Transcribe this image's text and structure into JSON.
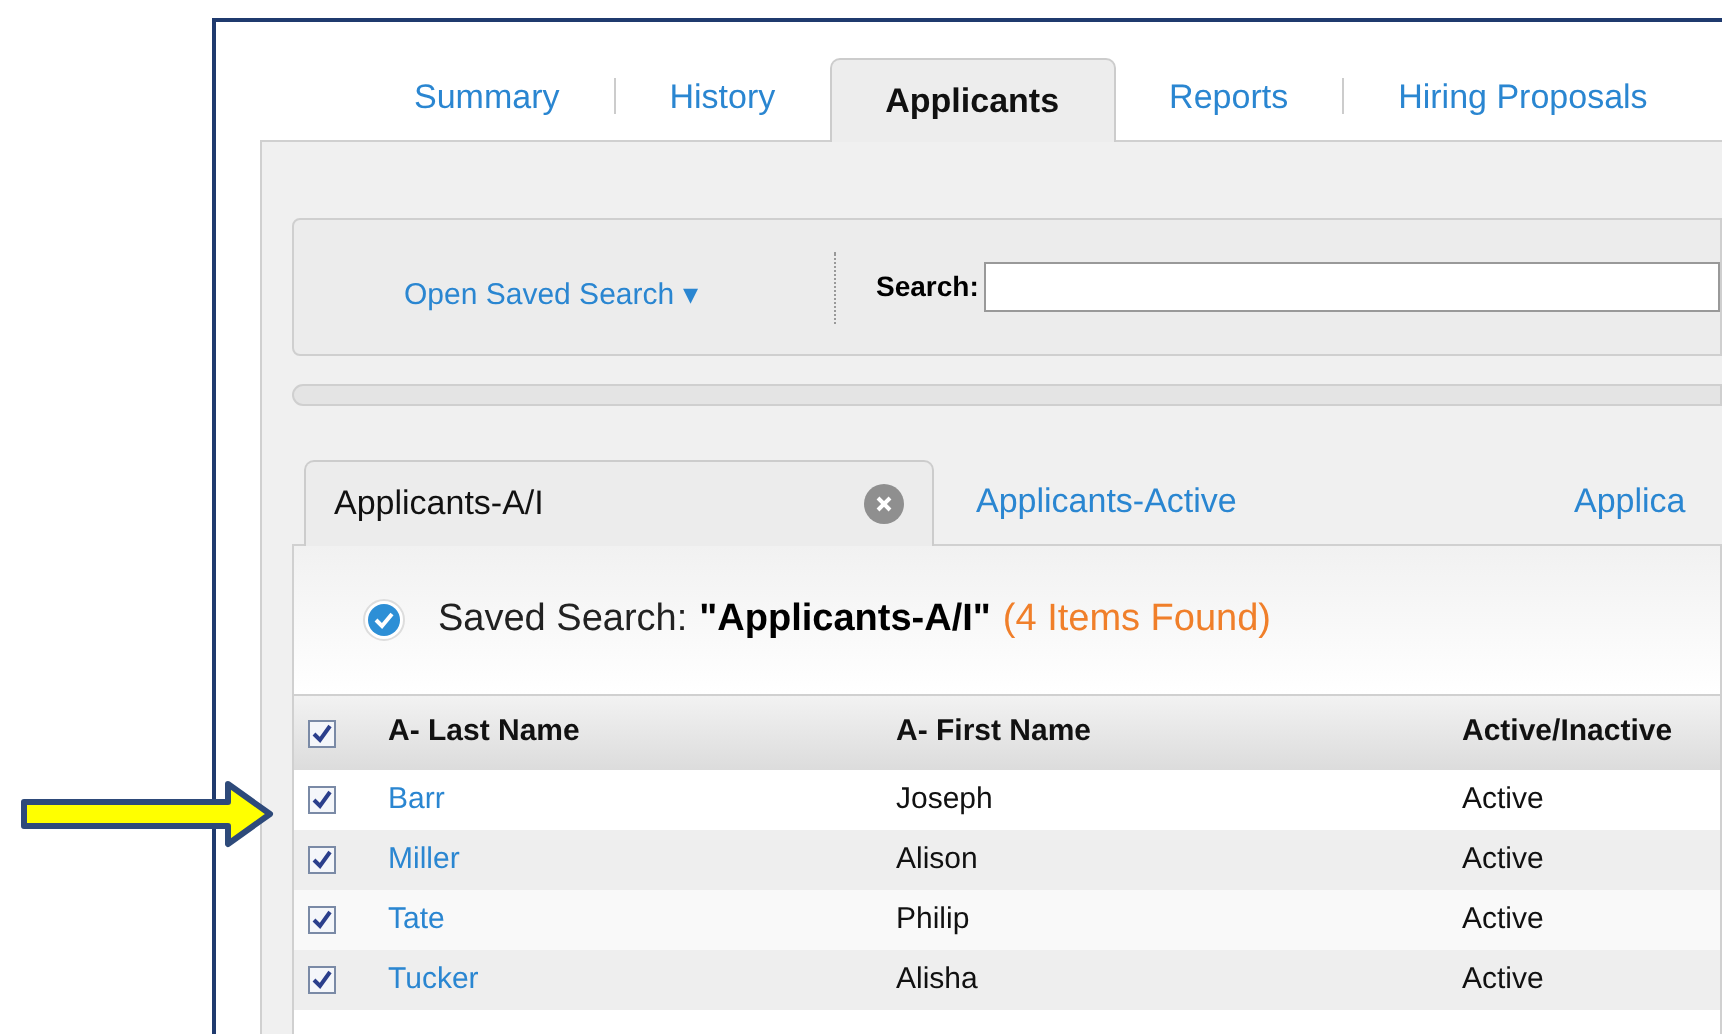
{
  "tabs": [
    {
      "label": "Summary",
      "selected": false
    },
    {
      "label": "History",
      "selected": false
    },
    {
      "label": "Applicants",
      "selected": true
    },
    {
      "label": "Reports",
      "selected": false
    },
    {
      "label": "Hiring Proposals",
      "selected": false
    }
  ],
  "search_bar": {
    "open_saved_search": "Open Saved Search ▾",
    "search_label": "Search:"
  },
  "saved_search_tabs": [
    {
      "label": "Applicants-A/I",
      "selected": true,
      "closable": true
    },
    {
      "label": "Applicants-Active",
      "selected": false,
      "closable": false
    },
    {
      "label": "Applica",
      "selected": false,
      "closable": false
    }
  ],
  "saved_search": {
    "label": "Saved Search:",
    "name": "\"Applicants-A/I\"",
    "count": "(4 Items Found)"
  },
  "table": {
    "all_checked": true,
    "columns": [
      "A- Last Name",
      "A- First Name",
      "Active/Inactive"
    ],
    "rows": [
      {
        "checked": true,
        "highlighted": true,
        "cells": [
          "Barr",
          "Joseph",
          "Active"
        ]
      },
      {
        "checked": true,
        "highlighted": false,
        "cells": [
          "Miller",
          "Alison",
          "Active"
        ]
      },
      {
        "checked": true,
        "highlighted": false,
        "cells": [
          "Tate",
          "Philip",
          "Active"
        ]
      },
      {
        "checked": true,
        "highlighted": false,
        "cells": [
          "Tucker",
          "Alisha",
          "Active"
        ]
      }
    ]
  }
}
